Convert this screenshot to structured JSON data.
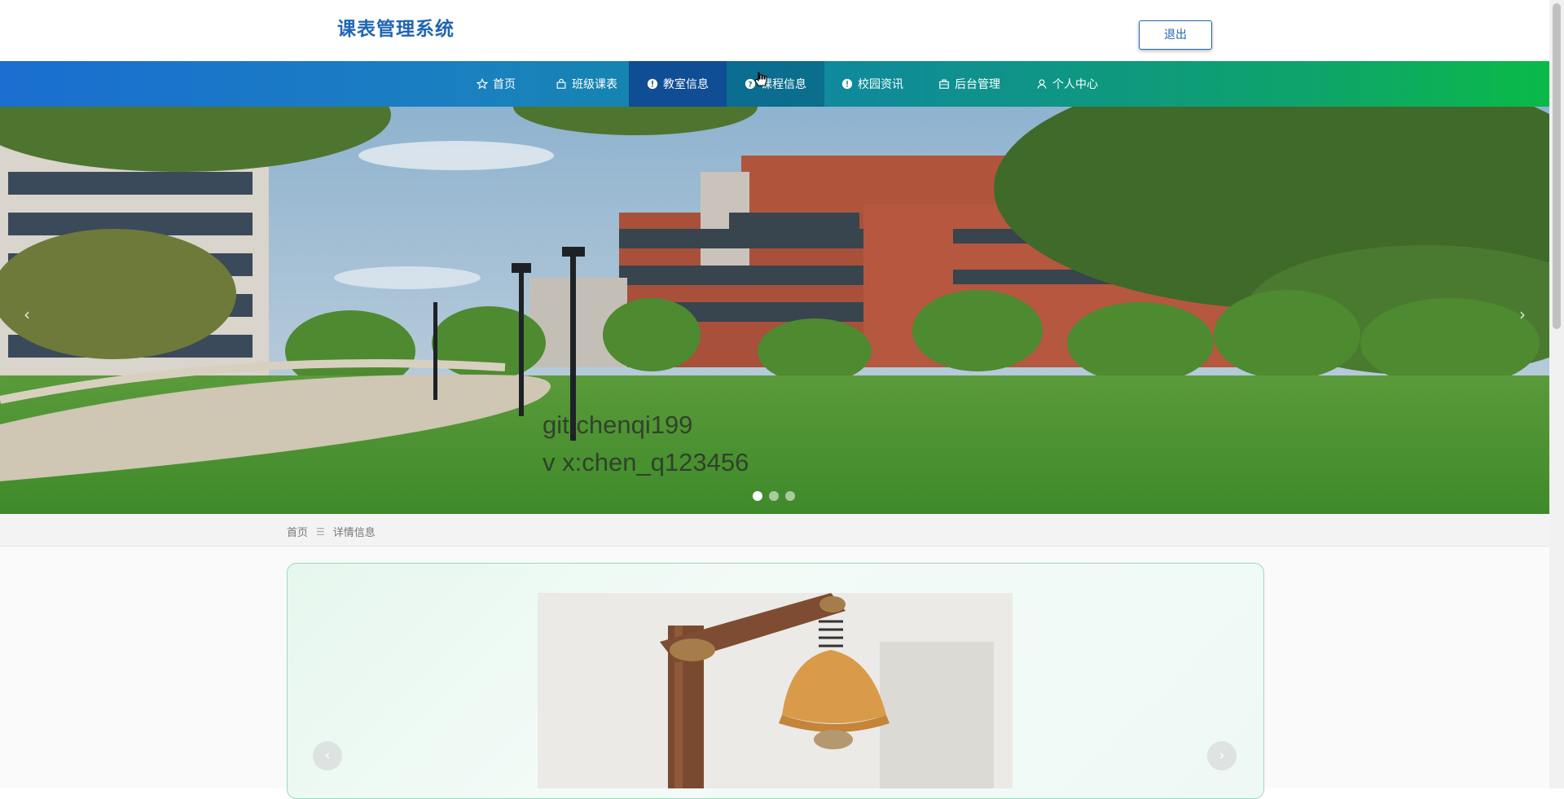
{
  "header": {
    "title": "课表管理系统",
    "logout_label": "退出"
  },
  "nav": {
    "items": [
      {
        "label": "首页",
        "icon": "star-icon"
      },
      {
        "label": "班级课表",
        "icon": "bag-icon"
      },
      {
        "label": "教室信息",
        "icon": "info-circle-icon"
      },
      {
        "label": "课程信息",
        "icon": "question-circle-icon"
      },
      {
        "label": "校园资讯",
        "icon": "info-circle-icon"
      },
      {
        "label": "后台管理",
        "icon": "briefcase-icon"
      },
      {
        "label": "个人中心",
        "icon": "user-icon"
      }
    ],
    "active_item": "教室信息",
    "hovered_item": "课程信息"
  },
  "banner": {
    "watermark_line1": "git:chenqi199",
    "watermark_line2": "v x:chen_q123456",
    "slide_count": 3,
    "current_slide": 1,
    "prev_label": "‹",
    "next_label": "›"
  },
  "breadcrumb": {
    "home": "首页",
    "separator": "☰",
    "current": "详情信息"
  },
  "detail": {
    "prev_label": "‹",
    "next_label": "›"
  },
  "colors": {
    "brand": "#2166b3",
    "nav_gradient_start": "#1a6ed0",
    "nav_gradient_end": "#0aba48",
    "nav_active": "#0f4d94",
    "card_border": "#9ad9bd"
  }
}
